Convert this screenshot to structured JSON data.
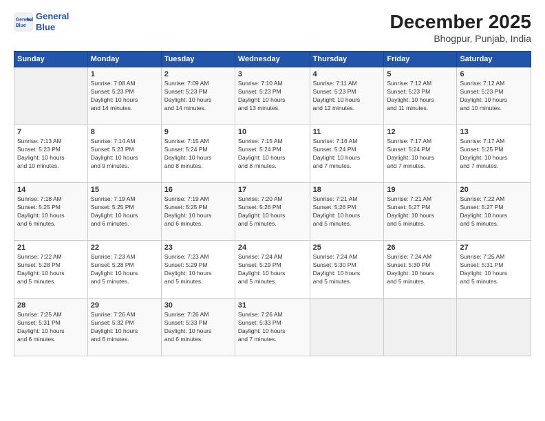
{
  "logo": {
    "line1": "General",
    "line2": "Blue"
  },
  "title": "December 2025",
  "location": "Bhogpur, Punjab, India",
  "headers": [
    "Sunday",
    "Monday",
    "Tuesday",
    "Wednesday",
    "Thursday",
    "Friday",
    "Saturday"
  ],
  "weeks": [
    [
      {
        "day": "",
        "info": ""
      },
      {
        "day": "1",
        "info": "Sunrise: 7:08 AM\nSunset: 5:23 PM\nDaylight: 10 hours\nand 14 minutes."
      },
      {
        "day": "2",
        "info": "Sunrise: 7:09 AM\nSunset: 5:23 PM\nDaylight: 10 hours\nand 14 minutes."
      },
      {
        "day": "3",
        "info": "Sunrise: 7:10 AM\nSunset: 5:23 PM\nDaylight: 10 hours\nand 13 minutes."
      },
      {
        "day": "4",
        "info": "Sunrise: 7:11 AM\nSunset: 5:23 PM\nDaylight: 10 hours\nand 12 minutes."
      },
      {
        "day": "5",
        "info": "Sunrise: 7:12 AM\nSunset: 5:23 PM\nDaylight: 10 hours\nand 11 minutes."
      },
      {
        "day": "6",
        "info": "Sunrise: 7:12 AM\nSunset: 5:23 PM\nDaylight: 10 hours\nand 10 minutes."
      }
    ],
    [
      {
        "day": "7",
        "info": "Sunrise: 7:13 AM\nSunset: 5:23 PM\nDaylight: 10 hours\nand 10 minutes."
      },
      {
        "day": "8",
        "info": "Sunrise: 7:14 AM\nSunset: 5:23 PM\nDaylight: 10 hours\nand 9 minutes."
      },
      {
        "day": "9",
        "info": "Sunrise: 7:15 AM\nSunset: 5:24 PM\nDaylight: 10 hours\nand 8 minutes."
      },
      {
        "day": "10",
        "info": "Sunrise: 7:15 AM\nSunset: 5:24 PM\nDaylight: 10 hours\nand 8 minutes."
      },
      {
        "day": "11",
        "info": "Sunrise: 7:16 AM\nSunset: 5:24 PM\nDaylight: 10 hours\nand 7 minutes."
      },
      {
        "day": "12",
        "info": "Sunrise: 7:17 AM\nSunset: 5:24 PM\nDaylight: 10 hours\nand 7 minutes."
      },
      {
        "day": "13",
        "info": "Sunrise: 7:17 AM\nSunset: 5:25 PM\nDaylight: 10 hours\nand 7 minutes."
      }
    ],
    [
      {
        "day": "14",
        "info": "Sunrise: 7:18 AM\nSunset: 5:25 PM\nDaylight: 10 hours\nand 6 minutes."
      },
      {
        "day": "15",
        "info": "Sunrise: 7:19 AM\nSunset: 5:25 PM\nDaylight: 10 hours\nand 6 minutes."
      },
      {
        "day": "16",
        "info": "Sunrise: 7:19 AM\nSunset: 5:25 PM\nDaylight: 10 hours\nand 6 minutes."
      },
      {
        "day": "17",
        "info": "Sunrise: 7:20 AM\nSunset: 5:26 PM\nDaylight: 10 hours\nand 5 minutes."
      },
      {
        "day": "18",
        "info": "Sunrise: 7:21 AM\nSunset: 5:26 PM\nDaylight: 10 hours\nand 5 minutes."
      },
      {
        "day": "19",
        "info": "Sunrise: 7:21 AM\nSunset: 5:27 PM\nDaylight: 10 hours\nand 5 minutes."
      },
      {
        "day": "20",
        "info": "Sunrise: 7:22 AM\nSunset: 5:27 PM\nDaylight: 10 hours\nand 5 minutes."
      }
    ],
    [
      {
        "day": "21",
        "info": "Sunrise: 7:22 AM\nSunset: 5:28 PM\nDaylight: 10 hours\nand 5 minutes."
      },
      {
        "day": "22",
        "info": "Sunrise: 7:23 AM\nSunset: 5:28 PM\nDaylight: 10 hours\nand 5 minutes."
      },
      {
        "day": "23",
        "info": "Sunrise: 7:23 AM\nSunset: 5:29 PM\nDaylight: 10 hours\nand 5 minutes."
      },
      {
        "day": "24",
        "info": "Sunrise: 7:24 AM\nSunset: 5:29 PM\nDaylight: 10 hours\nand 5 minutes."
      },
      {
        "day": "25",
        "info": "Sunrise: 7:24 AM\nSunset: 5:30 PM\nDaylight: 10 hours\nand 5 minutes."
      },
      {
        "day": "26",
        "info": "Sunrise: 7:24 AM\nSunset: 5:30 PM\nDaylight: 10 hours\nand 5 minutes."
      },
      {
        "day": "27",
        "info": "Sunrise: 7:25 AM\nSunset: 5:31 PM\nDaylight: 10 hours\nand 5 minutes."
      }
    ],
    [
      {
        "day": "28",
        "info": "Sunrise: 7:25 AM\nSunset: 5:31 PM\nDaylight: 10 hours\nand 6 minutes."
      },
      {
        "day": "29",
        "info": "Sunrise: 7:26 AM\nSunset: 5:32 PM\nDaylight: 10 hours\nand 6 minutes."
      },
      {
        "day": "30",
        "info": "Sunrise: 7:26 AM\nSunset: 5:33 PM\nDaylight: 10 hours\nand 6 minutes."
      },
      {
        "day": "31",
        "info": "Sunrise: 7:26 AM\nSunset: 5:33 PM\nDaylight: 10 hours\nand 7 minutes."
      },
      {
        "day": "",
        "info": ""
      },
      {
        "day": "",
        "info": ""
      },
      {
        "day": "",
        "info": ""
      }
    ]
  ]
}
